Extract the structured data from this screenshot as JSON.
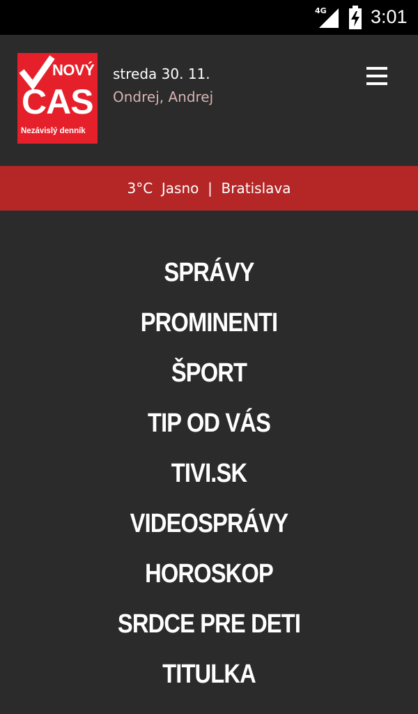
{
  "status_bar": {
    "network": "4G",
    "time": "3:01"
  },
  "header": {
    "logo": {
      "brand_top": "NOVÝ",
      "brand_main": "CAS",
      "tagline": "Nezávislý denník"
    },
    "date": "streda 30. 11.",
    "nameday": "Ondrej, Andrej",
    "menu_icon": "hamburger-icon"
  },
  "weather": {
    "text": "3°C  Jasno  |  Bratislava"
  },
  "nav": {
    "items": [
      {
        "label": "SPRÁVY"
      },
      {
        "label": "PROMINENTI"
      },
      {
        "label": "ŠPORT"
      },
      {
        "label": "TIP OD VÁS"
      },
      {
        "label": "TIVI.SK"
      },
      {
        "label": "VIDEOSPRÁVY"
      },
      {
        "label": "HOROSKOP"
      },
      {
        "label": "SRDCE PRE DETI"
      },
      {
        "label": "TITULKA"
      }
    ]
  },
  "colors": {
    "background": "#2b2b2b",
    "weather_bar": "#b52727",
    "logo_red": "#e5202a",
    "nameday_text": "#d8b3b3"
  }
}
